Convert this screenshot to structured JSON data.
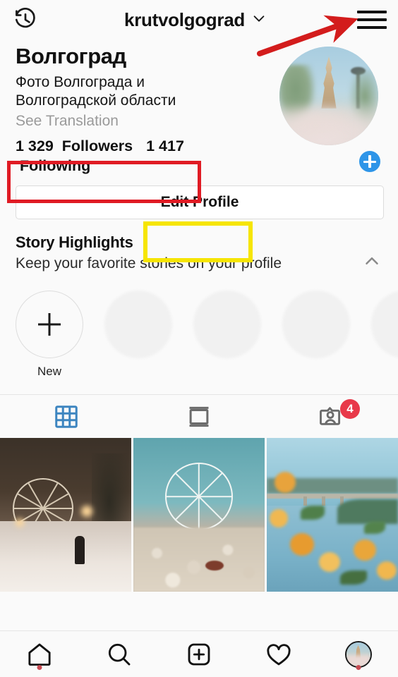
{
  "header": {
    "archive_icon": "history-clock-icon",
    "username": "krutvolgograd",
    "chevron_icon": "chevron-down-icon",
    "menu_icon": "hamburger-menu-icon"
  },
  "profile": {
    "display_name": "Волгоград",
    "bio_line1": "Фото Волгограда и",
    "bio_line2": "Волгоградской области",
    "see_translation": "See Translation",
    "followers_count": "1 329",
    "followers_label": "Followers",
    "following_count": "1 417",
    "following_label": "Following",
    "avatar_name": "profile-picture",
    "add_story_icon": "plus-icon"
  },
  "edit_profile": {
    "label": "Edit Profile"
  },
  "story_highlights": {
    "title": "Story Highlights",
    "subtitle": "Keep your favorite stories on your profile",
    "collapse_icon": "chevron-up-icon",
    "new_label": "New",
    "new_icon": "plus-icon",
    "placeholder_count": 4
  },
  "tabs": [
    {
      "name": "grid-tab",
      "icon": "grid-icon",
      "active": true,
      "badge": null
    },
    {
      "name": "reels-tab",
      "icon": "panel-icon",
      "active": false,
      "badge": null
    },
    {
      "name": "tagged-tab",
      "icon": "tagged-person-icon",
      "active": false,
      "badge": "4"
    }
  ],
  "posts": [
    {
      "name": "post-thumbnail-1",
      "description": "Snowy night path with illuminated ferris wheel and a person walking"
    },
    {
      "name": "post-thumbnail-2",
      "description": "Daytime ferris wheel seen over a pebble beach"
    },
    {
      "name": "post-thumbnail-3",
      "description": "Bridge over the river with orange flowers in the foreground"
    }
  ],
  "bottom_nav": [
    {
      "name": "nav-home",
      "icon": "home-icon",
      "dot": true
    },
    {
      "name": "nav-search",
      "icon": "search-icon",
      "dot": false
    },
    {
      "name": "nav-create",
      "icon": "plus-square-icon",
      "dot": false
    },
    {
      "name": "nav-activity",
      "icon": "heart-icon",
      "dot": false
    },
    {
      "name": "nav-profile",
      "icon": "avatar-icon",
      "dot": true
    }
  ],
  "annotations": {
    "red_box_target": "followers-following-stats",
    "yellow_box_target": "edit-profile-label",
    "red_arrow_target": "hamburger-menu-icon"
  },
  "colors": {
    "background": "#fafafa",
    "active_tab": "#3d85c0",
    "badge_red": "#e8394a",
    "annotation_red": "#e01b24",
    "annotation_yellow": "#f6e500",
    "add_story_blue": "#2e95e8",
    "muted_text": "#9a9a9a"
  }
}
